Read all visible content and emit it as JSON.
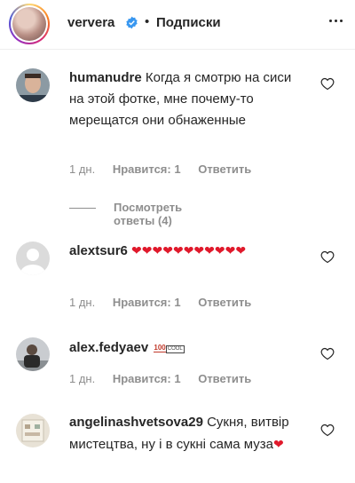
{
  "header": {
    "username": "ververa",
    "separator": "•",
    "follow_label": "Подписки"
  },
  "comments": [
    {
      "username": "humanudre",
      "text": "Когда я смотрю на сиси на этой фотке, мне почему-то мерещатся они обнаженные",
      "time": "1 дн.",
      "likes": "Нравится: 1",
      "reply": "Ответить",
      "view_replies": "Посмотреть ответы (4)"
    },
    {
      "username": "alextsur6",
      "text": "❤❤❤❤❤❤❤❤❤❤❤",
      "time": "1 дн.",
      "likes": "Нравится: 1",
      "reply": "Ответить"
    },
    {
      "username": "alex.fedyaev",
      "emoji_100": "100",
      "emoji_cool": "COOL",
      "time": "1 дн.",
      "likes": "Нравится: 1",
      "reply": "Ответить"
    },
    {
      "username": "angelinashvetsova29",
      "text": "Сукня, витвір мистецтва, ну і в сукні сама муза",
      "heart": "❤"
    }
  ],
  "colors": {
    "text": "#262626",
    "secondary": "#8e8e8e",
    "heart_red": "#e0192b",
    "verified_blue": "#3897f0"
  },
  "icons": [
    "verified-badge-icon",
    "more-options-icon",
    "like-heart-icon",
    "default-avatar-icon"
  ]
}
